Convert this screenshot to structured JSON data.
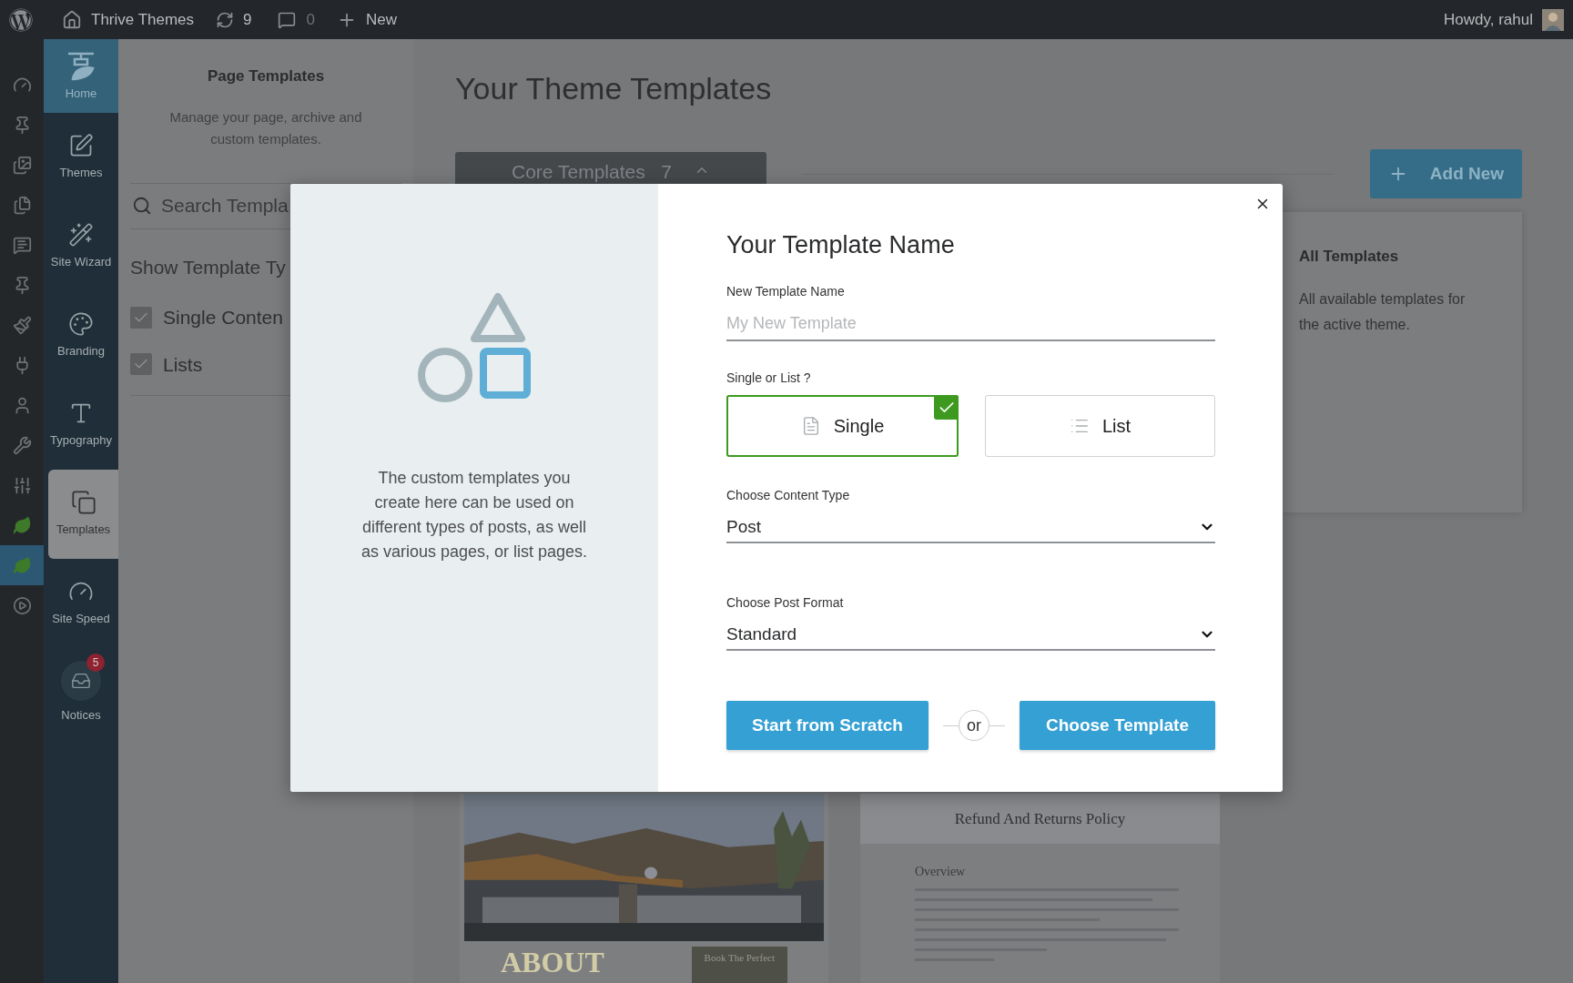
{
  "top_bar": {
    "site_name": "Thrive Themes",
    "updates": "9",
    "comments": "0",
    "new_label": "New",
    "greeting": "Howdy, rahul"
  },
  "admin_menu": {
    "items": [
      {
        "selected": false
      },
      {
        "selected": false
      },
      {
        "selected": false
      },
      {
        "selected": false
      },
      {
        "selected": false
      },
      {
        "selected": false
      },
      {
        "selected": false
      },
      {
        "selected": false
      },
      {
        "selected": false
      },
      {
        "selected": false
      },
      {
        "selected": false
      },
      {
        "selected": false
      },
      {
        "selected": true
      },
      {
        "selected": false
      }
    ]
  },
  "thrive_sidebar": {
    "home": {
      "label": "Home"
    },
    "items": [
      {
        "label": "Themes",
        "selected": false
      },
      {
        "label": "Site Wizard",
        "selected": false
      },
      {
        "label": "Branding",
        "selected": false
      },
      {
        "label": "Typography",
        "selected": false
      },
      {
        "label": "Templates",
        "selected": true
      },
      {
        "label": "Site Speed",
        "selected": false
      },
      {
        "label": "Notices",
        "selected": false,
        "badge": "5"
      }
    ]
  },
  "templates_panel": {
    "title": "Page Templates",
    "description": "Manage your page, archive and custom templates.",
    "search": {
      "placeholder": "Search Templa"
    },
    "filter_heading": "Show Template Ty",
    "filters": [
      {
        "label": "Single Conten",
        "checked": true
      },
      {
        "label": "Lists",
        "checked": true
      }
    ]
  },
  "main": {
    "title": "Your Theme Templates",
    "core_tab": {
      "label": "Core Templates",
      "count": "7",
      "expanded": true
    },
    "add_button": "Add New",
    "info_card": {
      "title": "All Templates",
      "description": "All available templates for the active theme."
    },
    "previews": [
      {
        "kind": "picture",
        "caption": "ABOUT",
        "tile": "Book The Perfect"
      },
      {
        "kind": "document",
        "heading": "Refund And Returns Policy",
        "subheading": "Overview"
      }
    ]
  },
  "modal": {
    "description": "The custom templates you create here can be used on different types of posts, as well as various pages, or list pages.",
    "heading": "Your Template Name",
    "name_field": {
      "label": "New Template Name",
      "placeholder": "My New Template"
    },
    "type_label": "Single or List ?",
    "options": [
      {
        "label": "Single",
        "selected": true
      },
      {
        "label": "List",
        "selected": false
      }
    ],
    "selects": [
      {
        "label": "Choose Content Type",
        "value": "Post"
      },
      {
        "label": "Choose Post Format",
        "value": "Standard"
      }
    ],
    "buttons": {
      "primary": "Start from Scratch",
      "separator": "or",
      "secondary": "Choose Template"
    }
  }
}
